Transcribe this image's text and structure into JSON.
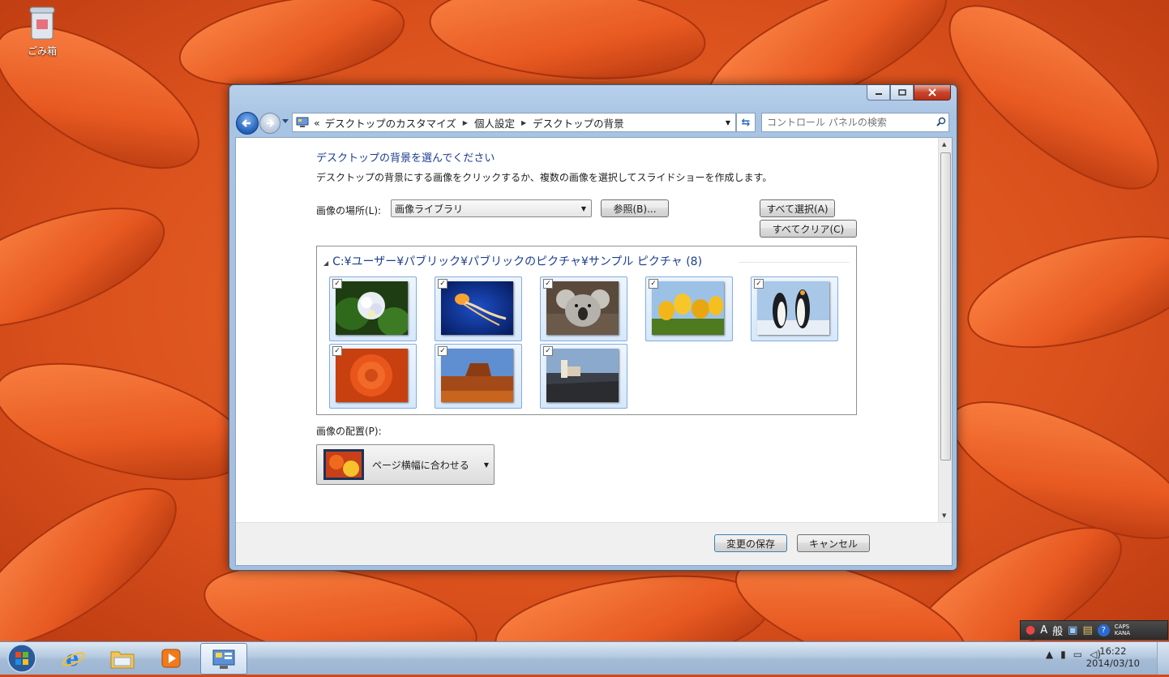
{
  "desktop": {
    "icons": [
      {
        "label": "ごみ箱",
        "icon": "recycle-bin-icon"
      }
    ]
  },
  "window": {
    "address": {
      "chevron": "«",
      "crumbs": [
        "デスクトップのカスタマイズ",
        "個人設定",
        "デスクトップの背景"
      ]
    },
    "search": {
      "placeholder": "コントロール パネルの検索"
    },
    "heading": "デスクトップの背景を選んでください",
    "description": "デスクトップの背景にする画像をクリックするか、複数の画像を選択してスライドショーを作成します。",
    "location_label": "画像の場所(L):",
    "location_value": "画像ライブラリ",
    "browse_button": "参照(B)...",
    "select_all_button": "すべて選択(A)",
    "clear_all_button": "すべてクリア(C)",
    "group_title": "C:¥ユーザー¥パブリック¥パブリックのピクチャ¥サンプル ピクチャ (8)",
    "thumbnails": [
      {
        "name": "hydrangeas",
        "checked": true
      },
      {
        "name": "jellyfish",
        "checked": true
      },
      {
        "name": "koala",
        "checked": true
      },
      {
        "name": "tulips",
        "checked": true
      },
      {
        "name": "penguins",
        "checked": true
      },
      {
        "name": "chrysanthemum",
        "checked": true
      },
      {
        "name": "desert",
        "checked": true
      },
      {
        "name": "lighthouse",
        "checked": true
      }
    ],
    "position_label": "画像の配置(P):",
    "position_value": "ページ横幅に合わせる",
    "save_button": "変更の保存",
    "cancel_button": "キャンセル"
  },
  "taskbar": {
    "apps": [
      "start-button",
      "internet-explorer",
      "windows-explorer",
      "windows-media-player",
      "control-panel"
    ],
    "ime": {
      "mode": "A",
      "dict": "般",
      "caps": "CAPS",
      "kana": "KANA"
    },
    "clock": {
      "time": "16:22",
      "date": "2014/03/10"
    }
  },
  "colors": {
    "accent": "#1c3d8f",
    "wallpaper": "#d24a1a"
  }
}
